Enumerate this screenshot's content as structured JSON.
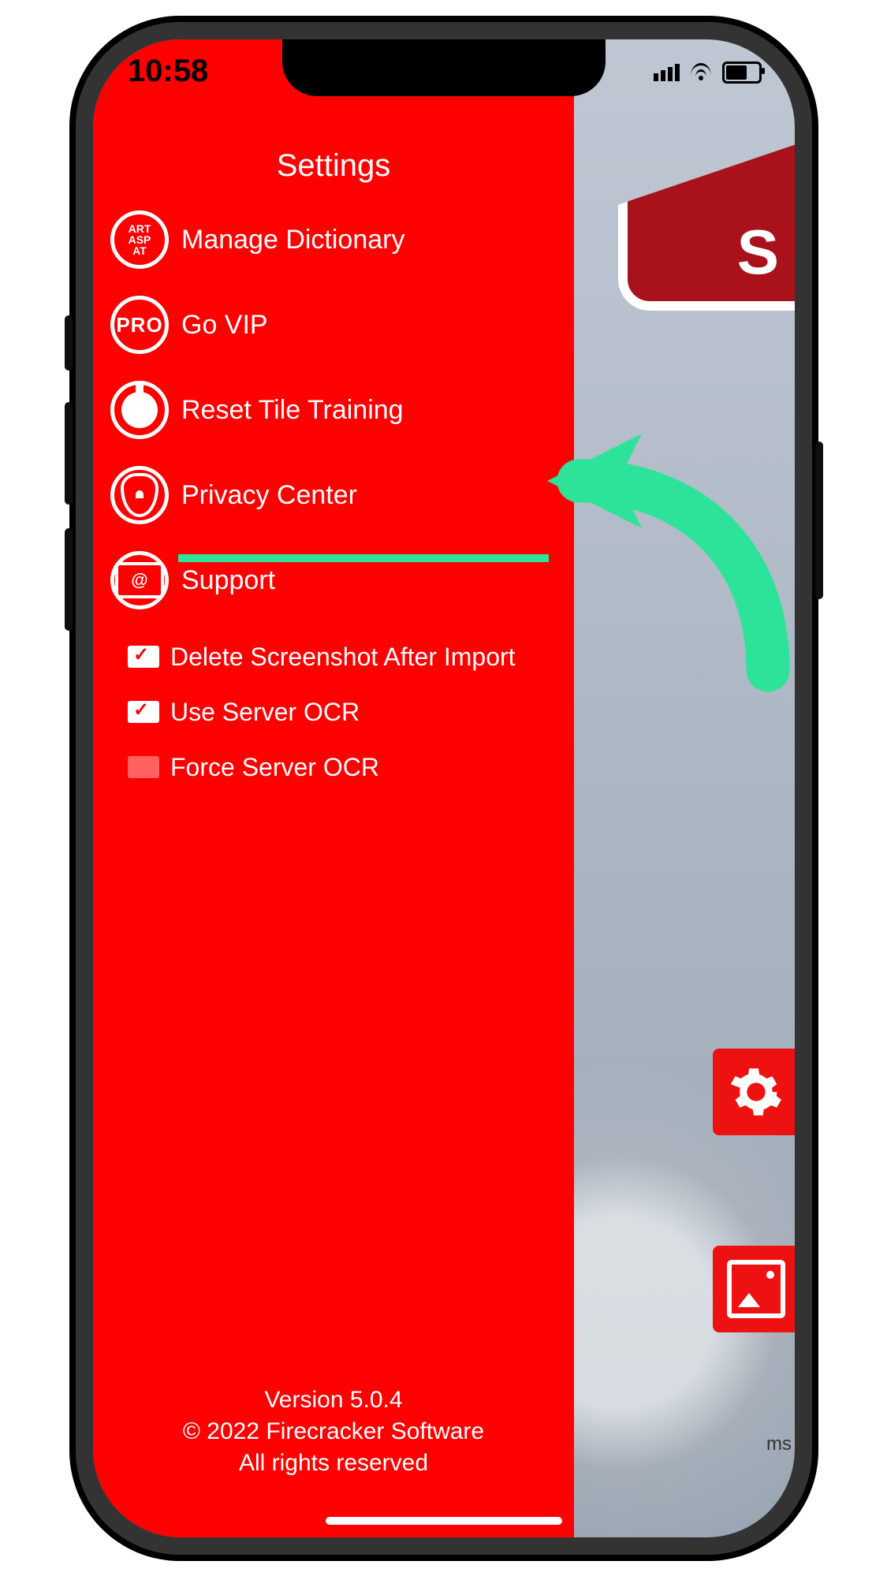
{
  "status": {
    "time": "10:58"
  },
  "menu": {
    "title": "Settings",
    "items": [
      {
        "label": "Manage Dictionary",
        "icon": "dictionary"
      },
      {
        "label": "Go VIP",
        "icon": "pro"
      },
      {
        "label": "Reset Tile Training",
        "icon": "bomb",
        "highlighted": true
      },
      {
        "label": "Privacy Center",
        "icon": "shield"
      },
      {
        "label": "Support",
        "icon": "mail"
      }
    ],
    "checks": [
      {
        "label": "Delete Screenshot After Import",
        "checked": true
      },
      {
        "label": "Use Server OCR",
        "checked": true
      },
      {
        "label": "Force Server OCR",
        "checked": false
      }
    ]
  },
  "peek": {
    "bottom_label": "ms"
  },
  "footer": {
    "version": "Version 5.0.4",
    "copyright": "© 2022 Firecracker Software",
    "rights": "All rights reserved"
  },
  "icon_text": {
    "pro": "PRO",
    "dict_stack": "ART\nASP\nAT"
  }
}
